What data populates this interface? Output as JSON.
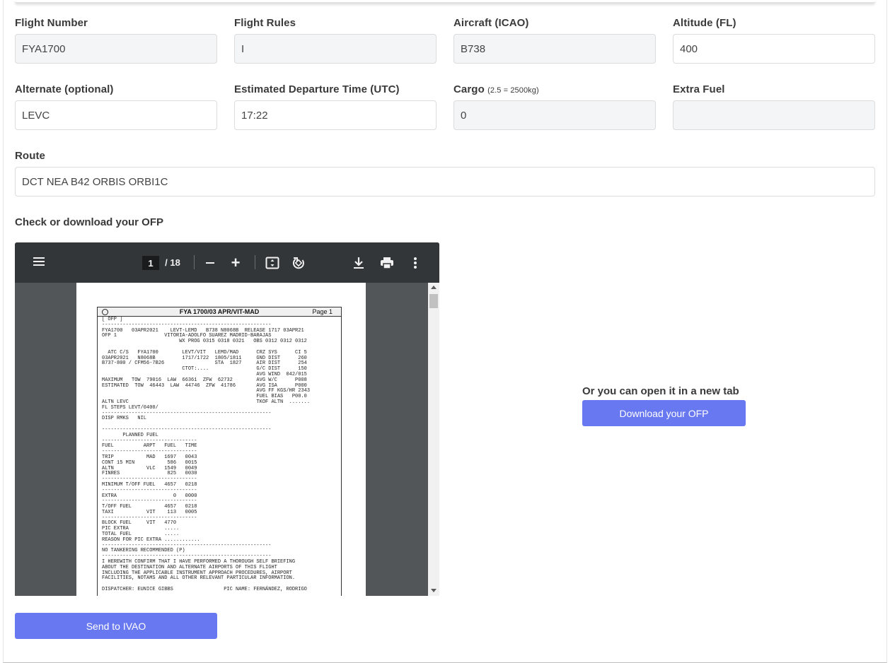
{
  "fields": {
    "flight_number": {
      "label": "Flight Number",
      "value": "FYA1700"
    },
    "flight_rules": {
      "label": "Flight Rules",
      "value": "I"
    },
    "aircraft": {
      "label": "Aircraft (ICAO)",
      "value": "B738"
    },
    "altitude": {
      "label": "Altitude (FL)",
      "value": "400"
    },
    "alternate": {
      "label": "Alternate (optional)",
      "value": "LEVC"
    },
    "departure_time": {
      "label": "Estimated Departure Time (UTC)",
      "value": "17:22"
    },
    "cargo": {
      "label": "Cargo",
      "note": "(2.5 = 2500kg)",
      "value": "0"
    },
    "extra_fuel": {
      "label": "Extra Fuel",
      "value": ""
    },
    "route": {
      "label": "Route",
      "value": "DCT NEA B42 ORBIS ORBI1C"
    }
  },
  "ofp_section": {
    "label": "Check or download your OFP",
    "open_label": "Or you can open it in a new tab",
    "download_button": "Download your OFP"
  },
  "pdf_viewer": {
    "current_page": "1",
    "total_pages": "/ 18",
    "doc_title": "FYA 1700/03 APR/VIT-MAD",
    "doc_page_label": "Page 1",
    "doc_text": "[ OFP ]\n---------------------------------------------------------\nFYA1700   03APR2021    LEVT-LEMD   B738 N8068B  RELEASE 1717 03APR21\nOFP 1                VITORIA-ADOLFO SUAREZ MADRID-BARAJAS\n                          WX PROG 0315 0318 0321   OBS 0312 0312 0312\n\n  ATC C/S   FYA1700        LEVT/VIT   LEMD/MAD      CRZ SYS      CI 5\n03APR2021   N8068B         1717/1722  1805/1811     GND DIST      260\nB737-800 / CFM56-7B26                 STA  1827     AIR DIST      254\n                           CTOT:....                G/C DIST      150\n                                                    AVG WIND  042/015\nMAXIMUM   TOW  79016  LAW  66361  ZFW  62732        AVG W/C      P008\nESTIMATED  TOW  46443  LAW  44746  ZFW  41786       AVG ISA      P000\n                                                    AVG FF KGS/HR 2343\n                                                    FUEL BIAS   P00.0\nALTN LEVC                                           TKOF ALTN  .......\nFL STEPS LEVT/0400/\n---------------------------------------------------------\nDISP RMKS   NIL\n\n---------------------------------------------------------\n       PLANNED FUEL\n--------------------------------\nFUEL          ARPT   FUEL   TIME\n--------------------------------\nTRIP           MAD   1697   0043\nCONT 15 MIN           586   0015\nALTN           VLC   1549   0049\nFINRES                825   0030\n--------------------------------\nMINIMUM T/OFF FUEL   4657   0218\n--------------------------------\nEXTRA                   0   0000\n--------------------------------\nT/OFF FUEL           4657   0218\nTAXI           VIT    113   0005\n--------------------------------\nBLOCK FUEL     VIT   4770\nPIC EXTRA            .....\nTOTAL FUEL           .....\nREASON FOR PIC EXTRA ............\n---------------------------------------------------------\nNO TANKERING RECOMMENDED (P)\n---------------------------------------------------------\nI HEREWITH CONFIRM THAT I HAVE PERFORMED A THOROUGH SELF BRIEFING\nABOUT THE DESTINATION AND ALTERNATE AIRPORTS OF THIS FLIGHT\nINCLUDING THE APPLICABLE INSTRUMENT APPROACH PROCEDURES, AIRPORT\nFACILITIES, NOTAMS AND ALL OTHER RELEVANT PARTICULAR INFORMATION.\n\nDISPATCHER: EUNICE GIBBS                 PIC NAME: FERNÁNDEZ, RODRIGO"
  },
  "send_button": "Send to IVAO",
  "colors": {
    "button": "#6878f0",
    "pdf_toolbar": "#323639",
    "pdf_background": "#525659"
  },
  "icons": [
    "menu-icon",
    "zoom-out-icon",
    "zoom-in-icon",
    "fit-page-icon",
    "rotate-icon",
    "download-icon",
    "print-icon",
    "more-vert-icon"
  ]
}
